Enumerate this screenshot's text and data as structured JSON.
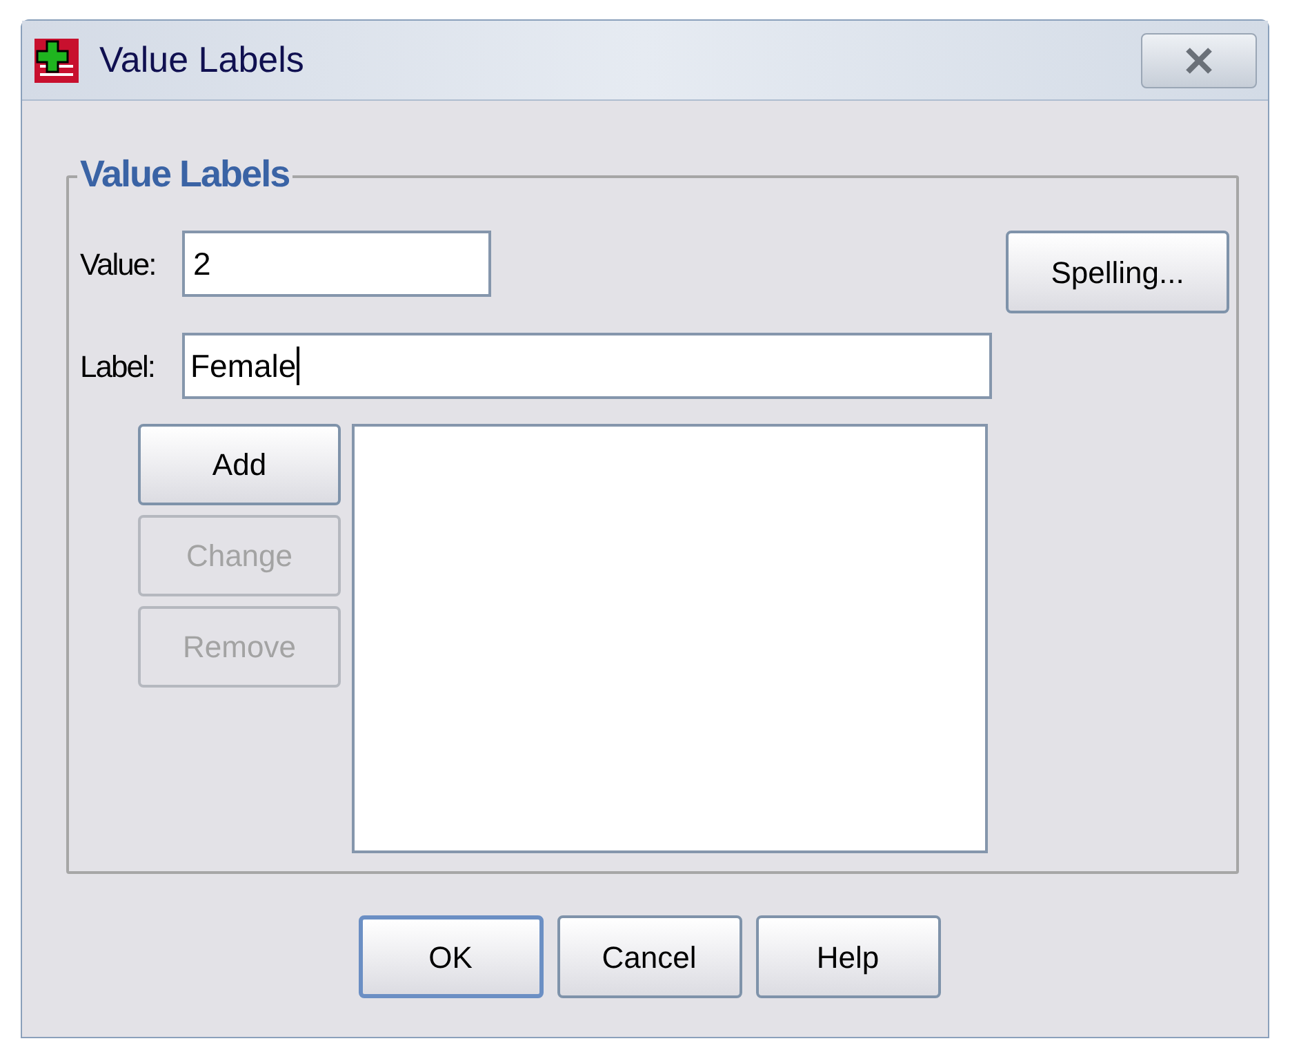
{
  "window": {
    "title": "Value Labels"
  },
  "group": {
    "title": "Value Labels"
  },
  "fields": [
    {
      "label": "Value:",
      "value": "2"
    },
    {
      "label": "Label:",
      "value": "Female"
    }
  ],
  "spelling_button": {
    "label": "Spelling...",
    "disabled": false
  },
  "list_buttons": [
    {
      "label": "Add",
      "disabled": false
    },
    {
      "label": "Change",
      "disabled": true
    },
    {
      "label": "Remove",
      "disabled": true
    }
  ],
  "dialog_buttons": [
    {
      "label": "OK",
      "default": true
    },
    {
      "label": "Cancel",
      "default": false
    },
    {
      "label": "Help",
      "default": false
    }
  ]
}
